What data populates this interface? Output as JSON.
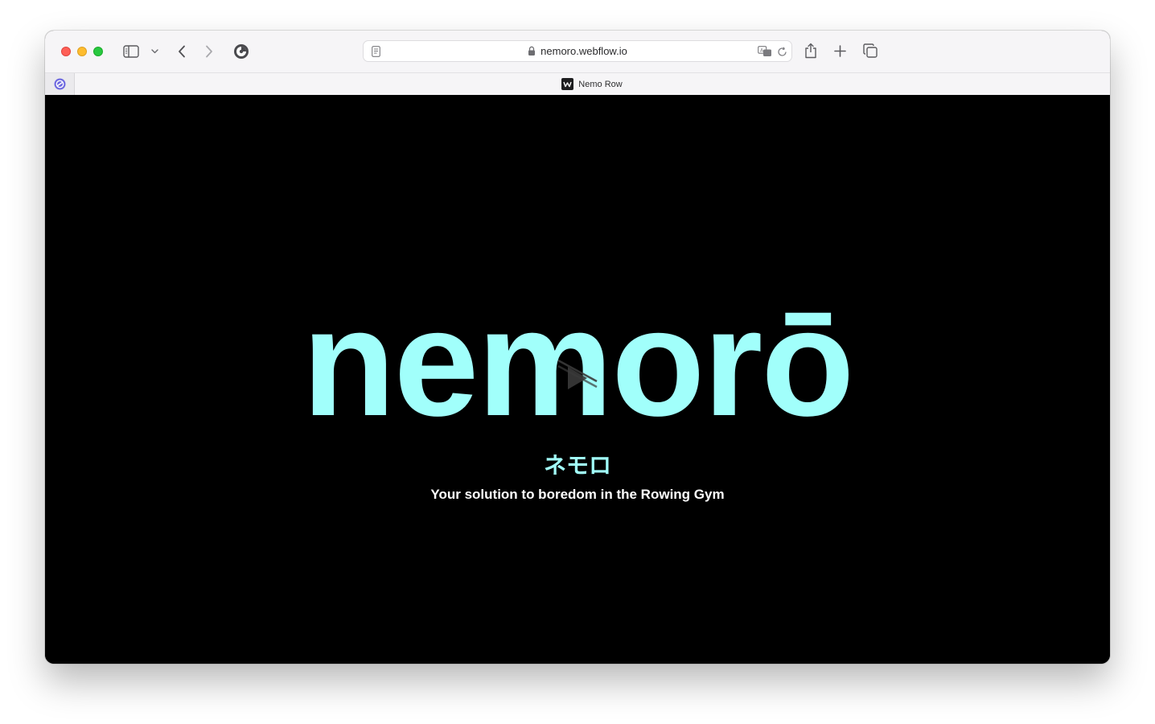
{
  "browser": {
    "address_bar": {
      "url": "nemoro.webflow.io"
    },
    "tabs": [
      {
        "title": "Nemo Row",
        "active": true
      }
    ]
  },
  "page": {
    "brand": "nemorō",
    "katakana": "ネモロ",
    "tagline": "Your solution to boredom in the Rowing Gym",
    "colors": {
      "background": "#000000",
      "accent": "#a1fffb",
      "tagline": "#ffffff"
    }
  },
  "icons": {
    "traffic_close": "close-circle-icon",
    "traffic_minimize": "minimize-circle-icon",
    "traffic_zoom": "zoom-circle-icon",
    "sidebar": "sidebar-icon",
    "back": "chevron-left-icon",
    "forward": "chevron-right-icon",
    "privacy": "privacy-report-icon",
    "reader": "reader-icon",
    "lock": "lock-icon",
    "translate": "translate-icon",
    "reload": "reload-icon",
    "share": "share-icon",
    "new_tab": "plus-icon",
    "tab_overview": "tab-overview-icon"
  }
}
